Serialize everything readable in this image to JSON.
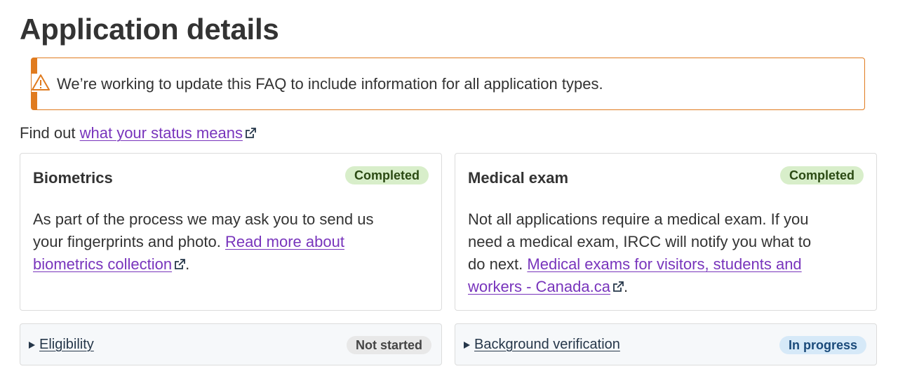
{
  "page": {
    "title": "Application details"
  },
  "alert": {
    "text": "We’re working to update this FAQ to include information for all application types."
  },
  "status_line": {
    "prefix": "Find out ",
    "link": "what your status means"
  },
  "cards": [
    {
      "title": "Biometrics",
      "status": "Completed",
      "body": "As part of the process we may ask you to send us your fingerprints and photo. ",
      "link": "Read more about biometrics collection",
      "suffix": "."
    },
    {
      "title": "Medical exam",
      "status": "Completed",
      "body": "Not all applications require a medical exam. If you need a medical exam, IRCC will notify you what to do next. ",
      "link": "Medical exams for visitors, students and workers - Canada.ca",
      "suffix": "."
    }
  ],
  "details": [
    {
      "label": "Eligibility",
      "status": "Not started"
    },
    {
      "label": "Background verification",
      "status": "In progress"
    }
  ],
  "colors": {
    "warning": "#e07b1f",
    "link": "#7834bc",
    "completed_bg": "#d8eeca",
    "notstarted_bg": "#e8e8e8",
    "inprogress_bg": "#d6e9f8"
  },
  "icons": {
    "alert": "warning-triangle-icon",
    "external": "external-link-icon",
    "expand": "triangle-right-icon"
  }
}
